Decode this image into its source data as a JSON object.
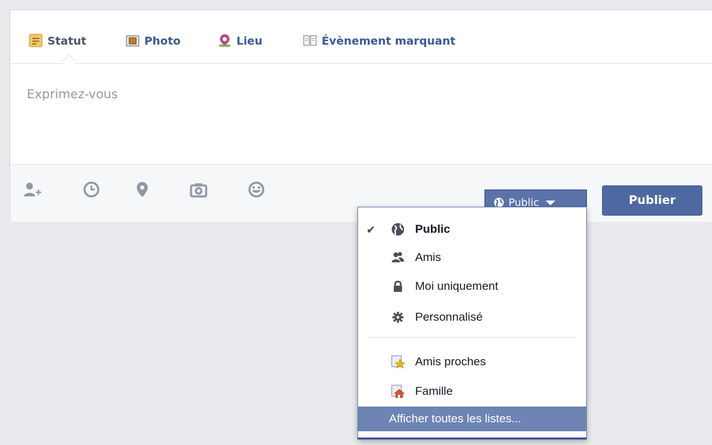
{
  "tabs": {
    "statut": "Statut",
    "photo": "Photo",
    "lieu": "Lieu",
    "evenement": "Évènement marquant"
  },
  "composer": {
    "placeholder": "Exprimez-vous"
  },
  "toolbar": {
    "tag_friends_icon": "tag-friends-icon",
    "clock_icon": "clock-icon",
    "location_icon": "location-pin-icon",
    "camera_icon": "camera-icon",
    "emoji_icon": "smiley-icon",
    "privacy_label": "Public",
    "publish_label": "Publier"
  },
  "dropdown": {
    "items": [
      {
        "label": "Public",
        "icon": "globe-icon",
        "selected": true
      },
      {
        "label": "Amis",
        "icon": "friends-icon",
        "selected": false
      },
      {
        "label": "Moi uniquement",
        "icon": "lock-icon",
        "selected": false
      },
      {
        "label": "Personnalisé",
        "icon": "gear-icon",
        "selected": false
      },
      {
        "label": "Amis proches",
        "icon": "star-list-icon",
        "selected": false
      },
      {
        "label": "Famille",
        "icon": "house-list-icon",
        "selected": false
      }
    ],
    "show_all": "Afficher toutes les listes..."
  },
  "colors": {
    "accent": "#3b5998",
    "button": "#4e69a2",
    "highlight": "#6d84b4"
  }
}
